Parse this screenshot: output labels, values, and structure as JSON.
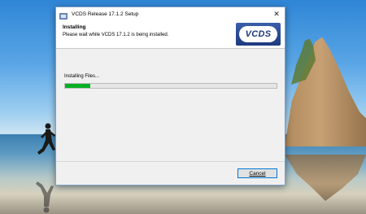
{
  "window": {
    "title": "VCDS Release 17.1.2 Setup",
    "close_glyph": "✕"
  },
  "header": {
    "title": "Installing",
    "subtitle": "Please wait while VCDS 17.1.2 is being installed.",
    "logo_text": "VCDS"
  },
  "main": {
    "status": "Installing Files...",
    "progress": 0.12,
    "progress_color": "#06b025"
  },
  "footer": {
    "cancel_label": "Cancel"
  },
  "icons": {
    "title_icon": "setup-installer-icon",
    "close_icon": "close-icon"
  }
}
